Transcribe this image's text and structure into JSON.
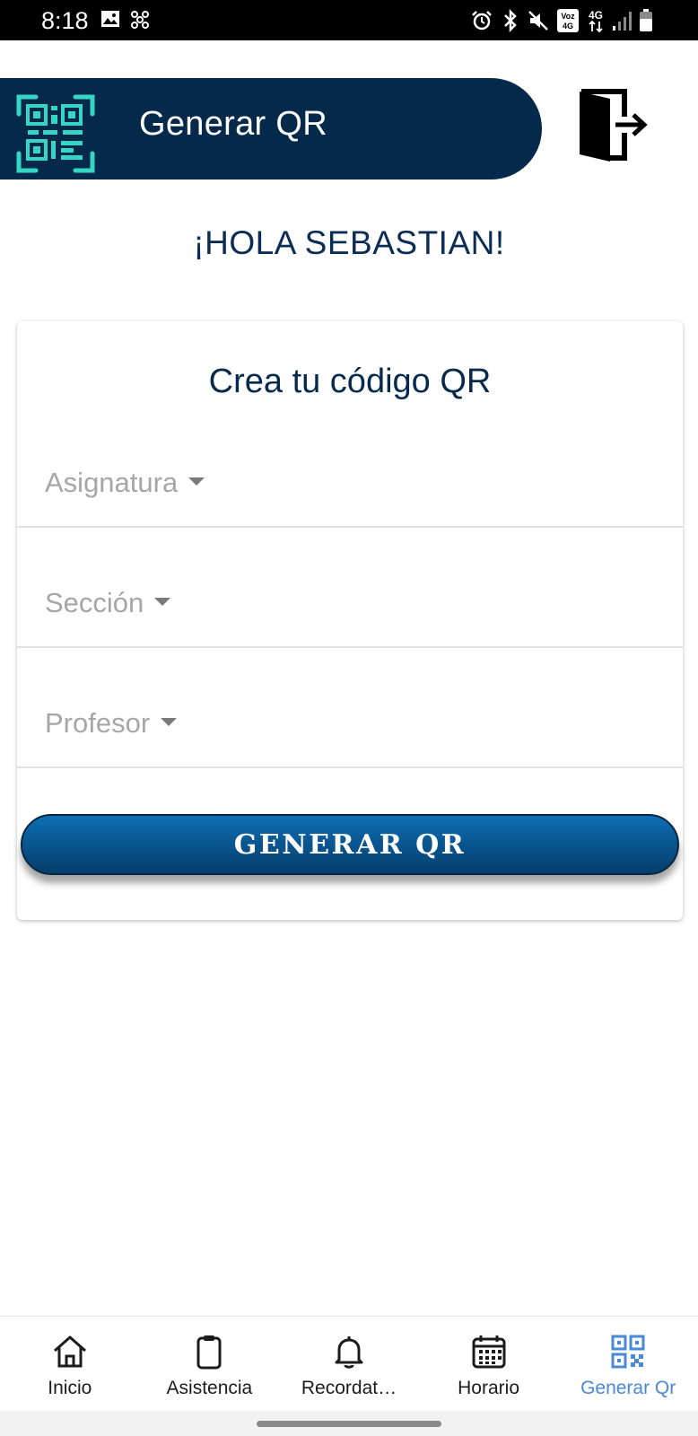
{
  "status_bar": {
    "time": "8:18",
    "left_icons": [
      "image-icon",
      "fan-icon"
    ],
    "right_icons": [
      "alarm-icon",
      "bluetooth-icon",
      "mute-icon",
      "volte-icon",
      "network-4g-icon",
      "signal-icon",
      "battery-icon"
    ],
    "volte_text": "Voz 4G",
    "network_text": "4G"
  },
  "header": {
    "title": "Generar QR",
    "background": "#04294b",
    "qr_color": "#35d6c6"
  },
  "greeting": "¡HOLA SEBASTIAN!",
  "card": {
    "title": "Crea tu código QR",
    "fields": [
      {
        "label": "Asignatura"
      },
      {
        "label": "Sección"
      },
      {
        "label": "Profesor"
      }
    ],
    "button_label": "GENERAR QR"
  },
  "bottom_nav": {
    "items": [
      {
        "label": "Inicio",
        "icon": "home-icon"
      },
      {
        "label": "Asistencia",
        "icon": "clipboard-icon"
      },
      {
        "label": "Recordat…",
        "icon": "bell-icon"
      },
      {
        "label": "Horario",
        "icon": "calendar-icon"
      },
      {
        "label": "Generar Qr",
        "icon": "qr-code-icon",
        "active": true
      }
    ],
    "active_color": "#4a88d8"
  }
}
